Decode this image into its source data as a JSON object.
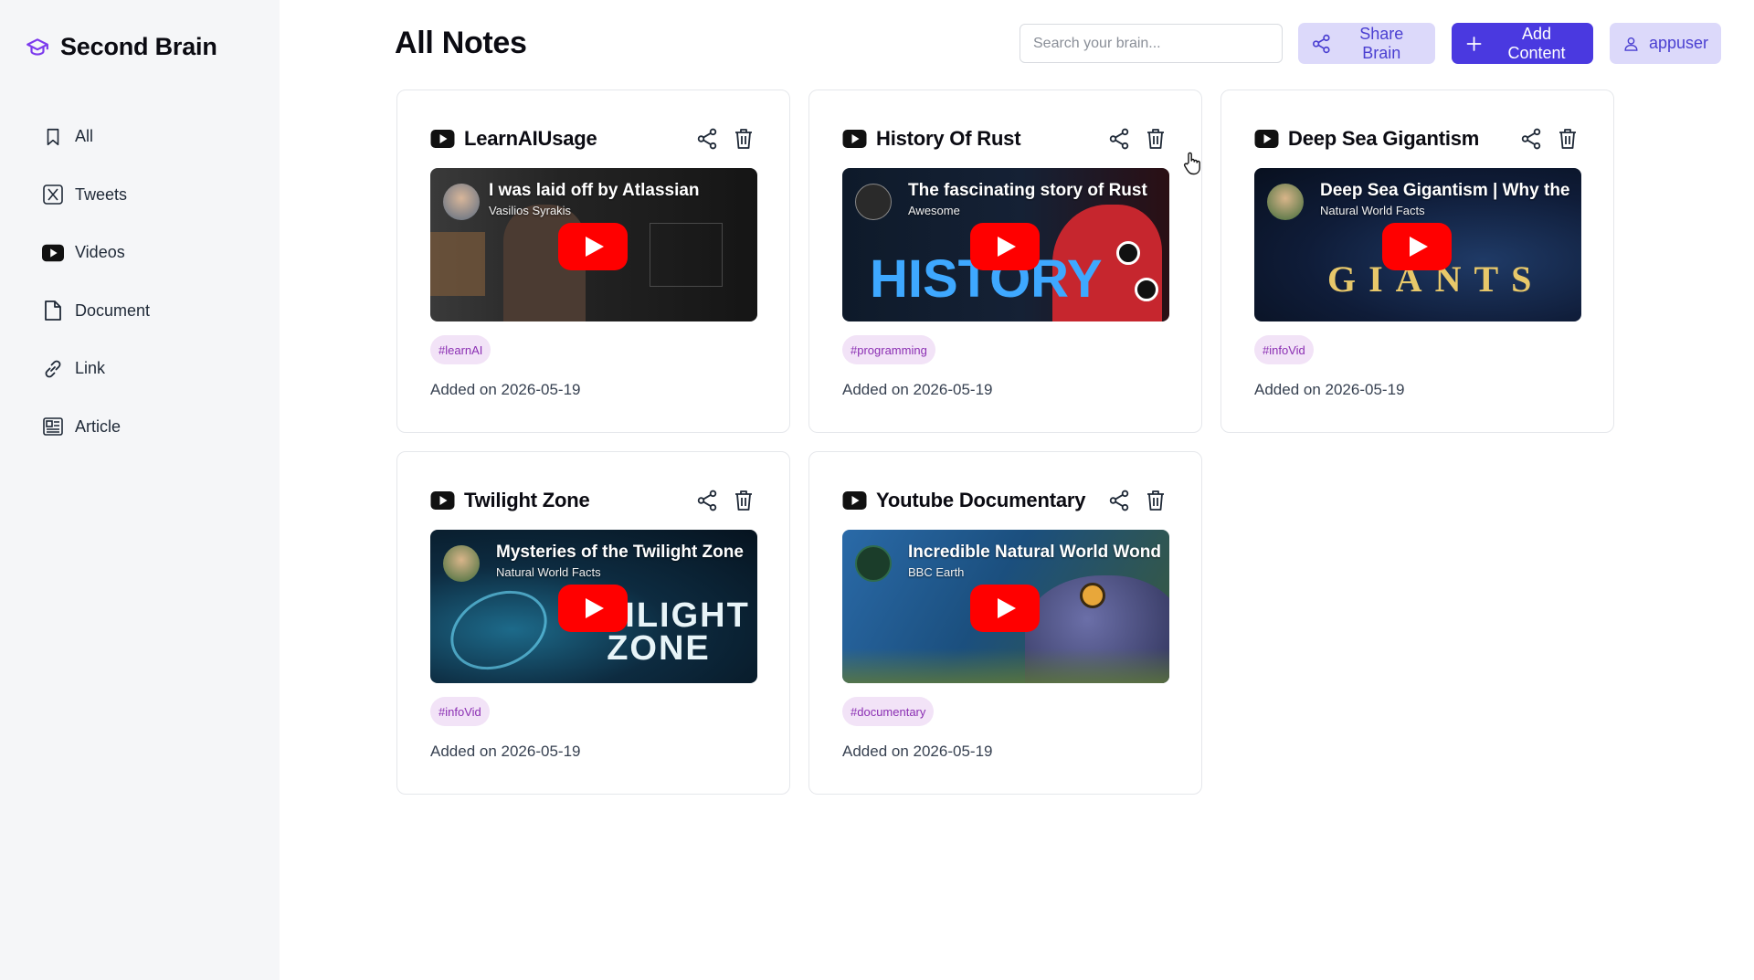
{
  "app": {
    "name": "Second Brain"
  },
  "sidebar": {
    "items": [
      {
        "label": "All",
        "icon": "bookmark-icon"
      },
      {
        "label": "Tweets",
        "icon": "x-logo-icon"
      },
      {
        "label": "Videos",
        "icon": "youtube-icon"
      },
      {
        "label": "Document",
        "icon": "document-icon"
      },
      {
        "label": "Link",
        "icon": "link-icon"
      },
      {
        "label": "Article",
        "icon": "newspaper-icon"
      }
    ]
  },
  "header": {
    "title": "All Notes",
    "search_placeholder": "Search your brain...",
    "share_label": "Share Brain",
    "add_label": "Add Content",
    "user_label": "appuser"
  },
  "colors": {
    "accent": "#4a39e0",
    "accent_soft": "#dcd9fa",
    "tag_bg": "#f2e3f7",
    "tag_text": "#8b2fb3",
    "youtube_red": "#ff0000"
  },
  "notes": [
    {
      "title": "LearnAIUsage",
      "video_title": "I was laid off by Atlassian",
      "channel": "Vasilios Syrakis",
      "tag": "#learnAI",
      "added": "Added on 2026-05-19",
      "overlay": ""
    },
    {
      "title": "History Of Rust",
      "video_title": "The fascinating story of Rust",
      "channel": "Awesome",
      "tag": "#programming",
      "added": "Added on 2026-05-19",
      "overlay": "HISTORY"
    },
    {
      "title": "Deep Sea Gigantism",
      "video_title": "Deep Sea Gigantism | Why the",
      "channel": "Natural World Facts",
      "tag": "#infoVid",
      "added": "Added on 2026-05-19",
      "overlay": "GIANTS"
    },
    {
      "title": "Twilight Zone",
      "video_title": "Mysteries of the Twilight Zone",
      "channel": "Natural World Facts",
      "tag": "#infoVid",
      "added": "Added on 2026-05-19",
      "overlay": "TWILIGHT ZONE"
    },
    {
      "title": "Youtube Documentary",
      "video_title": "Incredible Natural World Wonders",
      "channel": "BBC Earth",
      "tag": "#documentary",
      "added": "Added on 2026-05-19",
      "overlay": ""
    }
  ]
}
